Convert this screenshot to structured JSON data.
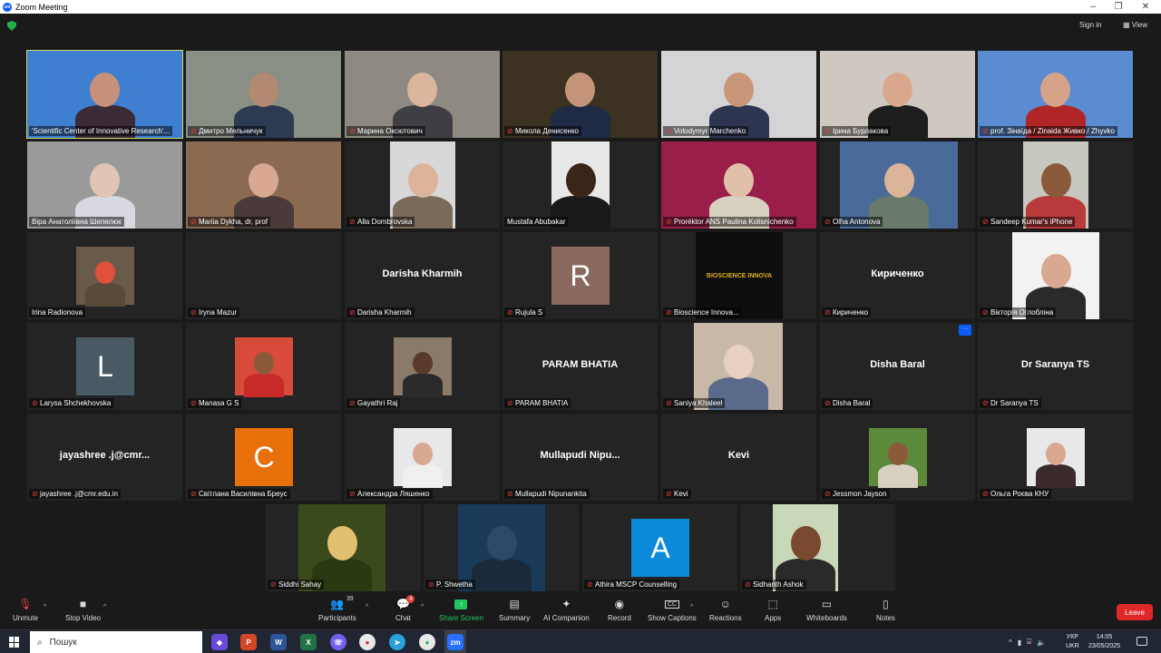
{
  "window": {
    "title": "Zoom Meeting"
  },
  "header": {
    "sign_in": "Sign in",
    "view": "View"
  },
  "tiles": [
    {
      "name": "'Scientific Center of Innovative Research'...",
      "type": "video",
      "muted": false,
      "active": true,
      "bg": "#3f7fd0",
      "head": "#c8907a",
      "body": "#3a2b36"
    },
    {
      "name": "Дмитро Мельничук",
      "type": "video",
      "muted": true,
      "bg": "#8a8f86",
      "head": "#b28a72",
      "body": "#2c3a52"
    },
    {
      "name": "Марина Оксютович",
      "type": "video",
      "muted": true,
      "bg": "#8e8a82",
      "head": "#d9b69c",
      "body": "#3f3e44"
    },
    {
      "name": "Микола Денисенко",
      "type": "video",
      "muted": true,
      "bg": "#3c3222",
      "head": "#c49478",
      "body": "#1f2b44"
    },
    {
      "name": "Volodymyr Marchenko",
      "type": "video",
      "muted": true,
      "bg": "#d4d4d6",
      "head": "#c89678",
      "body": "#2e3550"
    },
    {
      "name": "Ірина  Бурлакова",
      "type": "video",
      "muted": true,
      "bg": "#cfc8c0",
      "head": "#d9a88c",
      "body": "#1e1e1e"
    },
    {
      "name": "prof. Зінаїда / Zinaida Живко / Zhyvko",
      "type": "video",
      "muted": true,
      "bg": "#5b8bd0",
      "head": "#d6a28a",
      "body": "#b02626"
    },
    {
      "name": "Віра Анатоліївна Шепелюк",
      "type": "video",
      "muted": false,
      "bg": "#9a9a9a",
      "head": "#e0c4b4",
      "body": "#d8d8e0"
    },
    {
      "name": "Mariia Dykha, dr, prof",
      "type": "video",
      "muted": true,
      "bg": "#8a6a50",
      "head": "#d8a890",
      "body": "#4a3a3a"
    },
    {
      "name": "Alla Dombrovska",
      "type": "video",
      "muted": true,
      "bg": "#d8d8d8",
      "head": "#dcb49a",
      "body": "#7a6a5a"
    },
    {
      "name": "Mustafa Abubakar",
      "type": "video",
      "muted": false,
      "bg": "#e8e8e8",
      "head": "#3a2618",
      "body": "#1a1a1a"
    },
    {
      "name": "Proréktor ANS Paulina Kolisnichenko",
      "type": "video",
      "muted": true,
      "bg": "#9a1e4a",
      "head": "#e0c0a8",
      "body": "#d8d0c0"
    },
    {
      "name": "Olha Antonova",
      "type": "video",
      "muted": true,
      "bg": "#4a6a9a",
      "head": "#dcb49a",
      "body": "#6a7a6a"
    },
    {
      "name": "Sandeep Kumar's iPhone",
      "type": "video",
      "muted": true,
      "bg": "#c8c8c0",
      "head": "#8a5a3a",
      "body": "#b83a3a"
    },
    {
      "name": "Irina Radionova",
      "type": "video",
      "muted": false,
      "bg": "#6a5a4a",
      "head": "#e0503a",
      "body": "#5a4a3a"
    },
    {
      "name": "Iryna Mazur",
      "type": "blank",
      "muted": true
    },
    {
      "name": "Darisha Kharmih",
      "type": "text",
      "muted": true,
      "display": "Darisha Kharmih"
    },
    {
      "name": "Rujula S",
      "type": "avatar",
      "muted": true,
      "letter": "R",
      "color": "#8a6a5e"
    },
    {
      "name": "Bioscience Innova...",
      "type": "logo",
      "muted": true,
      "logo": "BIOSCIENCE INNOVA"
    },
    {
      "name": "Кириченко",
      "type": "text",
      "muted": true,
      "display": "Кириченко"
    },
    {
      "name": "Вікторія Оглобліна",
      "type": "video",
      "muted": true,
      "bg": "#f2f2f2",
      "head": "#d8a890",
      "body": "#2a2a2a"
    },
    {
      "name": "Larysa Shchekhovska",
      "type": "avatar",
      "muted": true,
      "letter": "L",
      "color": "#4a5a64"
    },
    {
      "name": "Manasa G S",
      "type": "video",
      "muted": true,
      "bg": "#d84a3a",
      "head": "#8a5a3a",
      "body": "#c82a2a"
    },
    {
      "name": "Gayathri Raj",
      "type": "video",
      "muted": true,
      "bg": "#8a7a6a",
      "head": "#5a3a2a",
      "body": "#2a2a2a"
    },
    {
      "name": "PARAM BHATIA",
      "type": "text",
      "muted": true,
      "display": "PARAM BHATIA"
    },
    {
      "name": "Saniya Khaleel",
      "type": "video",
      "muted": true,
      "bg": "#c8b8a8",
      "head": "#e8d0c0",
      "body": "#5a6a8a"
    },
    {
      "name": "Disha Baral",
      "type": "text",
      "muted": true,
      "display": "Disha Baral"
    },
    {
      "name": "Dr Saranya TS",
      "type": "text",
      "muted": true,
      "display": "Dr Saranya TS"
    },
    {
      "name": "jayashree .j@cmr.edu.in",
      "type": "text",
      "muted": true,
      "display": "jayashree .j@cmr..."
    },
    {
      "name": "Світлана Василівна Бреус",
      "type": "avatar",
      "muted": true,
      "letter": "C",
      "color": "#e8700a"
    },
    {
      "name": "Александра Ляшенко",
      "type": "video",
      "muted": true,
      "bg": "#e8e8ea",
      "head": "#d8a890",
      "body": "#f0f0f0"
    },
    {
      "name": "Mullapudi Nipunankita",
      "type": "text",
      "muted": true,
      "display": "Mullapudi  Nipu..."
    },
    {
      "name": "Kevi",
      "type": "text",
      "muted": true,
      "display": "Kevi"
    },
    {
      "name": "Jessmon Jayson",
      "type": "video",
      "muted": true,
      "bg": "#5a8a3a",
      "head": "#8a5a3a",
      "body": "#d8d0c0"
    },
    {
      "name": "Ольга Роєва КНУ",
      "type": "video",
      "muted": true,
      "bg": "#e8e8e8",
      "head": "#d8a890",
      "body": "#3a2a2a"
    },
    {
      "name": "Siddhi Sahay",
      "type": "video",
      "muted": true,
      "bg": "#3a4a1a",
      "head": "#e0c070",
      "body": "#2a3a10"
    },
    {
      "name": "P. Shwetha",
      "type": "video",
      "muted": true,
      "bg": "#1a3a5a",
      "head": "#2a4a6a",
      "body": "#1a2a3a"
    },
    {
      "name": "Athira MSCP Counselling",
      "type": "avatar",
      "muted": true,
      "letter": "A",
      "color": "#0a8ad8"
    },
    {
      "name": "Sidhanth Ashok",
      "type": "video",
      "muted": true,
      "bg": "#c8d8b8",
      "head": "#7a4a30",
      "body": "#2a2a2a"
    }
  ],
  "toolbar": {
    "unmute": "Unmute",
    "stop_video": "Stop Video",
    "participants": "Participants",
    "participants_count": "39",
    "chat": "Chat",
    "chat_badge": "4",
    "share_screen": "Share Screen",
    "summary": "Summary",
    "ai_companion": "AI Companion",
    "record": "Record",
    "show_captions": "Show Captions",
    "reactions": "Reactions",
    "apps": "Apps",
    "whiteboards": "Whiteboards",
    "notes": "Notes",
    "leave": "Leave"
  },
  "taskbar": {
    "search_placeholder": "Пошук",
    "lang_top": "УКР",
    "lang_bottom": "UKR",
    "time": "14:05",
    "date": "23/05/2025"
  },
  "colors": {
    "share_green": "#22c55e",
    "leave_red": "#e02828",
    "active_border": "#c9d86a",
    "muted_red": "#e0433d"
  }
}
